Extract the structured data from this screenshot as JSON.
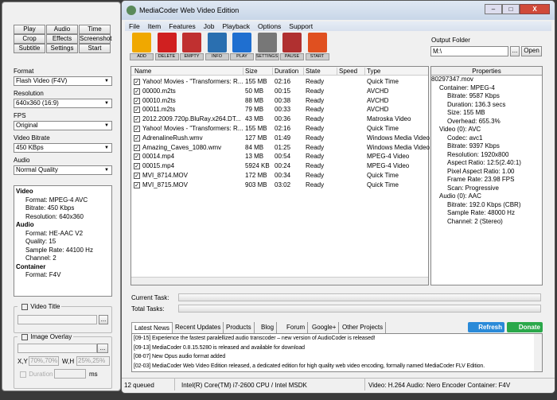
{
  "left": {
    "buttons": [
      "Play",
      "Audio",
      "Time",
      "Crop",
      "Effects",
      "Screenshot",
      "Subtitle",
      "Settings",
      "Start"
    ],
    "fields": [
      {
        "label": "Format",
        "value": "Flash Video (F4V)"
      },
      {
        "label": "Resolution",
        "value": "640x360 (16:9)"
      },
      {
        "label": "FPS",
        "value": "Original"
      },
      {
        "label": "Video Bitrate",
        "value": "450 KBps"
      },
      {
        "label": "Audio",
        "value": "Normal Quality"
      }
    ],
    "summary": [
      {
        "h": "Video"
      },
      {
        "c": "Format: MPEG-4 AVC"
      },
      {
        "c": "Bitrate: 450 Kbps"
      },
      {
        "c": "Resolution: 640x360"
      },
      {
        "h": "Audio"
      },
      {
        "c": "Format: HE-AAC V2"
      },
      {
        "c": "Quality: 15"
      },
      {
        "c": "Sample Rate: 44100 Hz"
      },
      {
        "c": "Channel: 2"
      },
      {
        "h": "Container"
      },
      {
        "c": "Format: F4V"
      }
    ],
    "video_title": "Video Title",
    "image_overlay": "Image Overlay",
    "xy_label": "X,Y",
    "xy_value": "70%,70%",
    "wh_label": "W,H",
    "wh_value": "25%,25%",
    "duration_label": "Duration",
    "ms_label": "ms",
    "browse": "..."
  },
  "window": {
    "title": "MediaCoder Web Video Edition",
    "menu": [
      "File",
      "Item",
      "Features",
      "Job",
      "Playback",
      "Options",
      "Support"
    ],
    "toolbar": [
      {
        "label": "ADD",
        "color": "#f0a800"
      },
      {
        "label": "DELETE",
        "color": "#d02020"
      },
      {
        "label": "EMPTY",
        "color": "#c03030"
      },
      {
        "label": "INFO",
        "color": "#2a6fb0"
      },
      {
        "label": "PLAY",
        "color": "#1f6fd0"
      },
      {
        "label": "SETTINGS",
        "color": "#777777"
      },
      {
        "label": "PAUSE",
        "color": "#b03030"
      },
      {
        "label": "START",
        "color": "#e05020"
      }
    ],
    "output_folder_label": "Output Folder",
    "output_folder": "M:\\",
    "browse": "...",
    "open": "Open"
  },
  "list": {
    "columns": [
      "Name",
      "Size",
      "Duration",
      "State",
      "Speed",
      "Type"
    ],
    "rows": [
      [
        "Yahoo! Movies - \"Transformers: R...",
        "155 MB",
        "02:16",
        "Ready",
        "",
        "Quick Time"
      ],
      [
        "00000.m2ts",
        "50 MB",
        "00:15",
        "Ready",
        "",
        "AVCHD"
      ],
      [
        "00010.m2ts",
        "88 MB",
        "00:38",
        "Ready",
        "",
        "AVCHD"
      ],
      [
        "00011.m2ts",
        "79 MB",
        "00:33",
        "Ready",
        "",
        "AVCHD"
      ],
      [
        "2012.2009.720p.BluRay.x264.DT...",
        "43 MB",
        "00:36",
        "Ready",
        "",
        "Matroska Video"
      ],
      [
        "Yahoo! Movies - \"Transformers: R...",
        "155 MB",
        "02:16",
        "Ready",
        "",
        "Quick Time"
      ],
      [
        "AdrenalineRush.wmv",
        "127 MB",
        "01:49",
        "Ready",
        "",
        "Windows Media Video"
      ],
      [
        "Amazing_Caves_1080.wmv",
        "84 MB",
        "01:25",
        "Ready",
        "",
        "Windows Media Video"
      ],
      [
        "00014.mp4",
        "13 MB",
        "00:54",
        "Ready",
        "",
        "MPEG-4 Video"
      ],
      [
        "00015.mp4",
        "5924 KB",
        "00:24",
        "Ready",
        "",
        "MPEG-4 Video"
      ],
      [
        "MVI_8714.MOV",
        "172 MB",
        "00:34",
        "Ready",
        "",
        "Quick Time"
      ],
      [
        "MVI_8715.MOV",
        "903 MB",
        "03:02",
        "Ready",
        "",
        "Quick Time"
      ]
    ]
  },
  "properties": {
    "header": "Properties",
    "items": [
      [
        0,
        "80297347.mov"
      ],
      [
        1,
        "Container: MPEG-4"
      ],
      [
        2,
        "Bitrate: 9587 Kbps"
      ],
      [
        2,
        "Duration: 136.3 secs"
      ],
      [
        2,
        "Size: 155 MB"
      ],
      [
        2,
        "Overhead: 655.3%"
      ],
      [
        1,
        "Video (0): AVC"
      ],
      [
        2,
        "Codec: avc1"
      ],
      [
        2,
        "Bitrate: 9397 Kbps"
      ],
      [
        2,
        "Resolution: 1920x800"
      ],
      [
        2,
        "Aspect Ratio: 12:5(2.40:1)"
      ],
      [
        2,
        "Pixel Aspect Ratio: 1.00"
      ],
      [
        2,
        "Frame Rate: 23.98 FPS"
      ],
      [
        2,
        "Scan: Progressive"
      ],
      [
        1,
        "Audio (0): AAC"
      ],
      [
        2,
        "Bitrate: 192.0 Kbps (CBR)"
      ],
      [
        2,
        "Sample Rate: 48000 Hz"
      ],
      [
        2,
        "Channel: 2 (Stereo)"
      ]
    ]
  },
  "progress": {
    "current": "Current Task:",
    "total": "Total Tasks:"
  },
  "news": {
    "tabs": [
      "Latest News",
      "Recent Updates",
      "Products",
      "Blog",
      "Forum",
      "Google+",
      "Other Projects"
    ],
    "refresh": "Refresh",
    "donate": "Donate",
    "items": [
      "[09-15] Experience the fastest paralellized audio transcoder – new version of AudioCoder is released!",
      "[09-13] MediaCoder 0.8.15.5280 is released and available for download",
      "[08-07] New Opus audio format added",
      "[02-03] MediaCoder Web Video Edition released, a dedicated edition for high quality web video encoding, formally named MediaCoder FLV Edition."
    ]
  },
  "status": {
    "queued": "12 queued",
    "cpu": "Intel(R) Core(TM) i7-2600 CPU  / Intel MSDK",
    "codecs": "Video: H.264  Audio: Nero Encoder  Container: F4V"
  }
}
